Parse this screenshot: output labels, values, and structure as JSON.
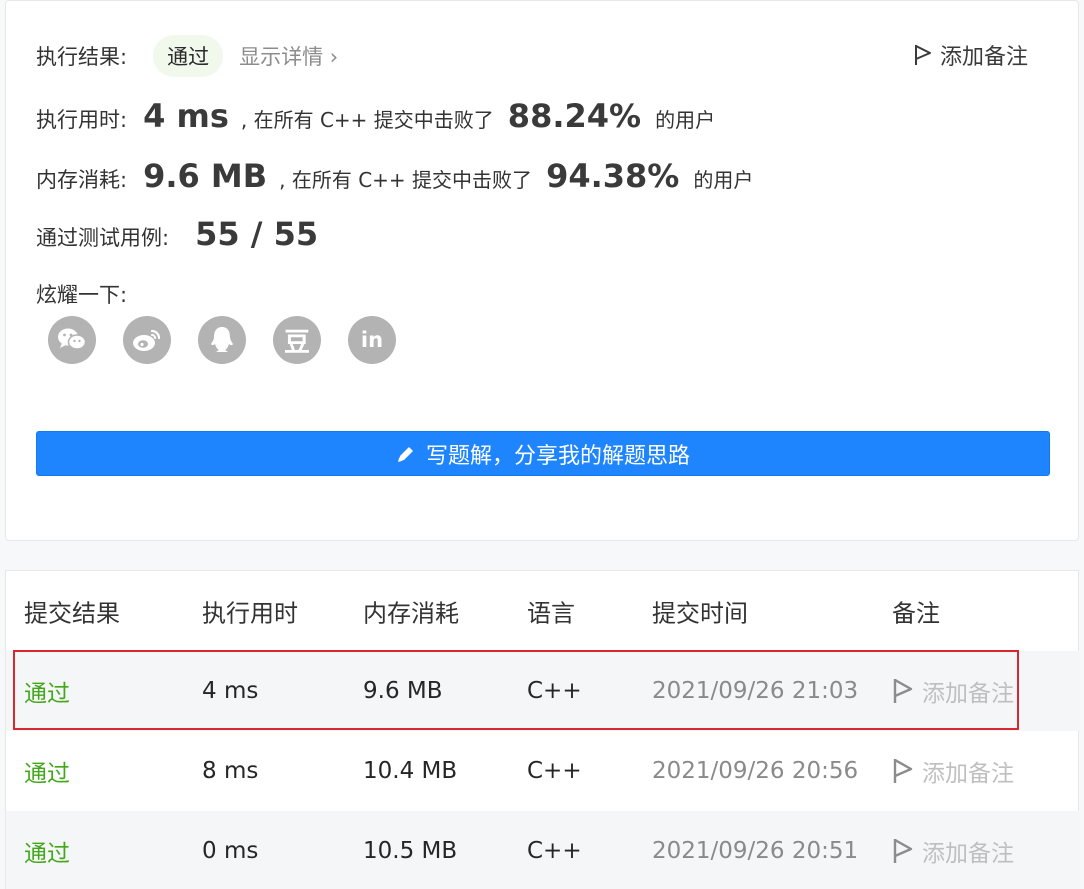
{
  "summary": {
    "result_label": "执行结果:",
    "result_badge": "通过",
    "details_link": "显示详情",
    "details_chevron": "›",
    "add_note": "添加备注",
    "runtime_label": "执行用时:",
    "runtime_value": "4 ms",
    "runtime_mid": ", 在所有 C++ 提交中击败了",
    "runtime_pct": "88.24%",
    "runtime_tail": "的用户",
    "memory_label": "内存消耗:",
    "memory_value": "9.6 MB",
    "memory_mid": ", 在所有 C++ 提交中击败了",
    "memory_pct": "94.38%",
    "memory_tail": "的用户",
    "tests_label": "通过测试用例:",
    "tests_value": "55 / 55",
    "share_label": "炫耀一下:",
    "share_icons": [
      "wechat-icon",
      "weibo-icon",
      "qq-icon",
      "douban-icon",
      "linkedin-icon"
    ],
    "douban_glyph": "豆",
    "linkedin_glyph": "in",
    "write_solution": "写题解，分享我的解题思路"
  },
  "table": {
    "headers": [
      "提交结果",
      "执行用时",
      "内存消耗",
      "语言",
      "提交时间",
      "备注"
    ],
    "rows": [
      {
        "result": "通过",
        "runtime": "4 ms",
        "memory": "9.6 MB",
        "lang": "C++",
        "time": "2021/09/26 21:03",
        "note": "添加备注"
      },
      {
        "result": "通过",
        "runtime": "8 ms",
        "memory": "10.4 MB",
        "lang": "C++",
        "time": "2021/09/26 20:56",
        "note": "添加备注"
      },
      {
        "result": "通过",
        "runtime": "0 ms",
        "memory": "10.5 MB",
        "lang": "C++",
        "time": "2021/09/26 20:51",
        "note": "添加备注"
      }
    ]
  },
  "colors": {
    "accent": "#1f85ff",
    "success": "#43a819",
    "highlight": "#d9262f"
  }
}
